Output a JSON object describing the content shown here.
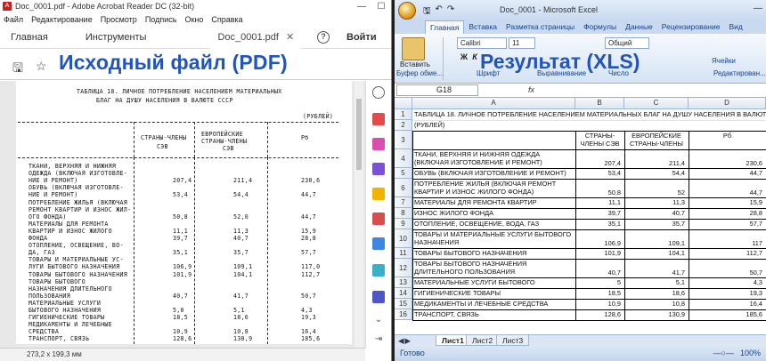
{
  "pdf": {
    "title": "Doc_0001.pdf - Adobe Acrobat Reader DC (32-bit)",
    "menu": [
      "Файл",
      "Редактирование",
      "Просмотр",
      "Подпись",
      "Окно",
      "Справка"
    ],
    "tabs": {
      "home": "Главная",
      "tools": "Инструменты",
      "doc": "Doc_0001.pdf",
      "help": "?",
      "signin": "Войти"
    },
    "overlay_label": "Исходный файл (PDF)",
    "status": "273,2 x 199,3 мм",
    "page_lines": [
      "ТАБЛИЦА 18. ЛИЧНОЕ ПОТРЕБЛЕНИЕ НАСЕЛЕНИЕМ МАТЕРИАЛЬНЫХ",
      "БЛАГ НА ДУШУ НАСЕЛЕНИЯ В ВАЛЮТЕ СССР",
      "(РУБЛЕЙ)",
      "СТРАНЫ-ЧЛЕНЫ",
      "СЭВ",
      "ЕВРОПЕЙСКИЕ",
      "СТРАНЫ-ЧЛЕНЫ",
      "СЭВ",
      "Рб"
    ],
    "rows": [
      [
        "ТКАНИ, ВЕРХНЯЯ И НИЖНЯЯ",
        "",
        ""
      ],
      [
        "ОДЕЖДА (ВКЛЮЧАЯ ИЗГОТОВЛЕ-",
        "",
        ""
      ],
      [
        "НИЕ И РЕМОНТ)",
        "207,4",
        "211,4",
        "230,6"
      ],
      [
        "ОБУВЬ (ВКЛЮЧАЯ ИЗГОТОВЛЕ-",
        "",
        ""
      ],
      [
        "НИЕ И РЕМОНТ)",
        "53,4",
        "54,4",
        "44,7"
      ],
      [
        "ПОТРЕБЛЕНИЕ ЖИЛЬЯ (ВКЛЮЧАЯ",
        "",
        ""
      ],
      [
        "РЕМОНТ КВАРТИР И ИЗНОС ЖИЛ-",
        "",
        ""
      ],
      [
        "ОГО ФОНДА)",
        "50,8",
        "52,0",
        "44,7"
      ],
      [
        "МАТЕРИАЛЫ ДЛЯ РЕМОНТА",
        "",
        ""
      ],
      [
        "КВАРТИР И ИЗНОС ЖИЛОГО",
        "11,1",
        "11,3",
        "15,9"
      ],
      [
        "ФОНДА",
        "39,7",
        "40,7",
        "28,8"
      ],
      [
        "ОТОПЛЕНИЕ, ОСВЕЩЕНИЕ, ВО-",
        "",
        ""
      ],
      [
        "ДА, ГАЗ",
        "35,1",
        "35,7",
        "57,7"
      ],
      [
        "ТОВАРЫ И МАТЕРИАЛЬНЫЕ УС-",
        "",
        ""
      ],
      [
        "ЛУГИ БЫТОВОГО НАЗНАЧЕНИЯ",
        "106,9",
        "109,1",
        "117,0"
      ],
      [
        "ТОВАРЫ БЫТОВОГО НАЗНАЧЕНИЯ",
        "101,9",
        "104,1",
        "112,7"
      ],
      [
        "ТОВАРЫ БЫТОВОГО",
        "",
        ""
      ],
      [
        "НАЗНАЧЕНИЯ ДЛИТЕЛЬНОГО",
        "",
        ""
      ],
      [
        "ПОЛЬЗОВАНИЯ",
        "40,7",
        "41,7",
        "50,7"
      ],
      [
        "МАТЕРИАЛЬНЫЕ УСЛУГИ",
        "",
        ""
      ],
      [
        "БЫТОВОГО НАЗНАЧЕНИЯ",
        "5,0",
        "5,1",
        "4,3"
      ],
      [
        "ГИГИЕНИЧЕСКИЕ ТОВАРЫ",
        "18,5",
        "18,6",
        "19,3"
      ],
      [
        "МЕДИКАМЕНТЫ И ЛЕЧЕБНЫЕ",
        "",
        ""
      ],
      [
        "СРЕДСТВА",
        "10,9",
        "10,8",
        "16,4"
      ],
      [
        "ТРАНСПОРТ, СВЯЗЬ",
        "128,6",
        "130,9",
        "185,6"
      ]
    ]
  },
  "excel": {
    "title": "Doc_0001 - Microsoft Excel",
    "tabs": [
      "Главная",
      "Вставка",
      "Разметка страницы",
      "Формулы",
      "Данные",
      "Рецензирование",
      "Вид"
    ],
    "ribbon": {
      "paste": "Вставить",
      "font_name": "Calibri",
      "font_size": "11",
      "number_format": "Общий",
      "cells": "Ячейки",
      "groups": [
        "Буфер обме...",
        "Шрифт",
        "Выравнивание",
        "Число",
        "Редактирован..."
      ]
    },
    "overlay_label": "Результат (XLS)",
    "name_box": "G18",
    "fx": "fx",
    "columns": [
      "A",
      "B",
      "C",
      "D"
    ],
    "rows": [
      {
        "n": "1",
        "a": "ТАБЛИЦА 18. ЛИЧНОЕ ПОТРЕБЛЕНИЕ НАСЕЛЕНИЕМ МАТЕРИАЛЬНЫХ БЛАГ НА ДУШУ НАСЕЛЕНИЯ В ВАЛЮТЕ СССР",
        "b": "",
        "c": "",
        "d": ""
      },
      {
        "n": "2",
        "a": "(РУБЛЕЙ)",
        "b": "",
        "c": "",
        "d": ""
      },
      {
        "n": "3",
        "a": "",
        "b": "СТРАНЫ-ЧЛЕНЫ СЭВ",
        "c": "ЕВРОПЕЙСКИЕ СТРАНЫ-ЧЛЕНЫ СЭВ",
        "d": "Рб"
      },
      {
        "n": "4",
        "a": "ТКАНИ, ВЕРХНЯЯ И НИЖНЯЯ ОДЕЖДА (ВКЛЮЧАЯ ИЗГОТОВЛЕНИЕ И РЕМОНТ)",
        "b": "207,4",
        "c": "211,4",
        "d": "230,6"
      },
      {
        "n": "5",
        "a": "ОБУВЬ (ВКЛЮЧАЯ ИЗГОТОВЛЕНИЕ И РЕМОНТ)",
        "b": "53,4",
        "c": "54,4",
        "d": "44,7"
      },
      {
        "n": "6",
        "a": "ПОТРЕБЛЕНИЕ ЖИЛЬЯ (ВКЛЮЧАЯ РЕМОНТ КВАРТИР И ИЗНОС ЖИЛОГО ФОНДА)",
        "b": "50,8",
        "c": "52",
        "d": "44,7"
      },
      {
        "n": "7",
        "a": "МАТЕРИАЛЫ ДЛЯ РЕМОНТА КВАРТИР",
        "b": "11,1",
        "c": "11,3",
        "d": "15,9"
      },
      {
        "n": "8",
        "a": "ИЗНОС ЖИЛОГО ФОНДА",
        "b": "39,7",
        "c": "40,7",
        "d": "28,8"
      },
      {
        "n": "9",
        "a": "ОТОПЛЕНИЕ, ОСВЕЩЕНИЕ, ВОДА, ГАЗ",
        "b": "35,1",
        "c": "35,7",
        "d": "57,7"
      },
      {
        "n": "10",
        "a": "ТОВАРЫ И МАТЕРИАЛЬНЫЕ УСЛУГИ БЫТОВОГО НАЗНАЧЕНИЯ",
        "b": "106,9",
        "c": "109,1",
        "d": "117"
      },
      {
        "n": "11",
        "a": "ТОВАРЫ БЫТОВОГО НАЗНАЧЕНИЯ",
        "b": "101,9",
        "c": "104,1",
        "d": "112,7"
      },
      {
        "n": "12",
        "a": "ТОВАРЫ БЫТОВОГО НАЗНАЧЕНИЯ ДЛИТЕЛЬНОГО ПОЛЬЗОВАНИЯ",
        "b": "40,7",
        "c": "41,7",
        "d": "50,7"
      },
      {
        "n": "13",
        "a": "МАТЕРИАЛЬНЫЕ УСЛУГИ БЫТОВОГО НАЗНАЧЕНИЯ",
        "b": "5",
        "c": "5,1",
        "d": "4,3"
      },
      {
        "n": "14",
        "a": "ГИГИЕНИЧЕСКИЕ ТОВАРЫ",
        "b": "18,5",
        "c": "18,6",
        "d": "19,3"
      },
      {
        "n": "15",
        "a": "МЕДИКАМЕНТЫ И ЛЕЧЕБНЫЕ СРЕДСТВА",
        "b": "10,9",
        "c": "10,8",
        "d": "16,4"
      },
      {
        "n": "16",
        "a": "ТРАНСПОРТ, СВЯЗЬ",
        "b": "128,6",
        "c": "130,9",
        "d": "185,6"
      }
    ],
    "sheets": [
      "Лист1",
      "Лист2",
      "Лист3"
    ],
    "status": "Готово",
    "zoom": "100%"
  },
  "colors": {
    "overlay_text": "#2255bb",
    "excel_accent": "#15428b",
    "pdf_red": "#c8201e"
  }
}
